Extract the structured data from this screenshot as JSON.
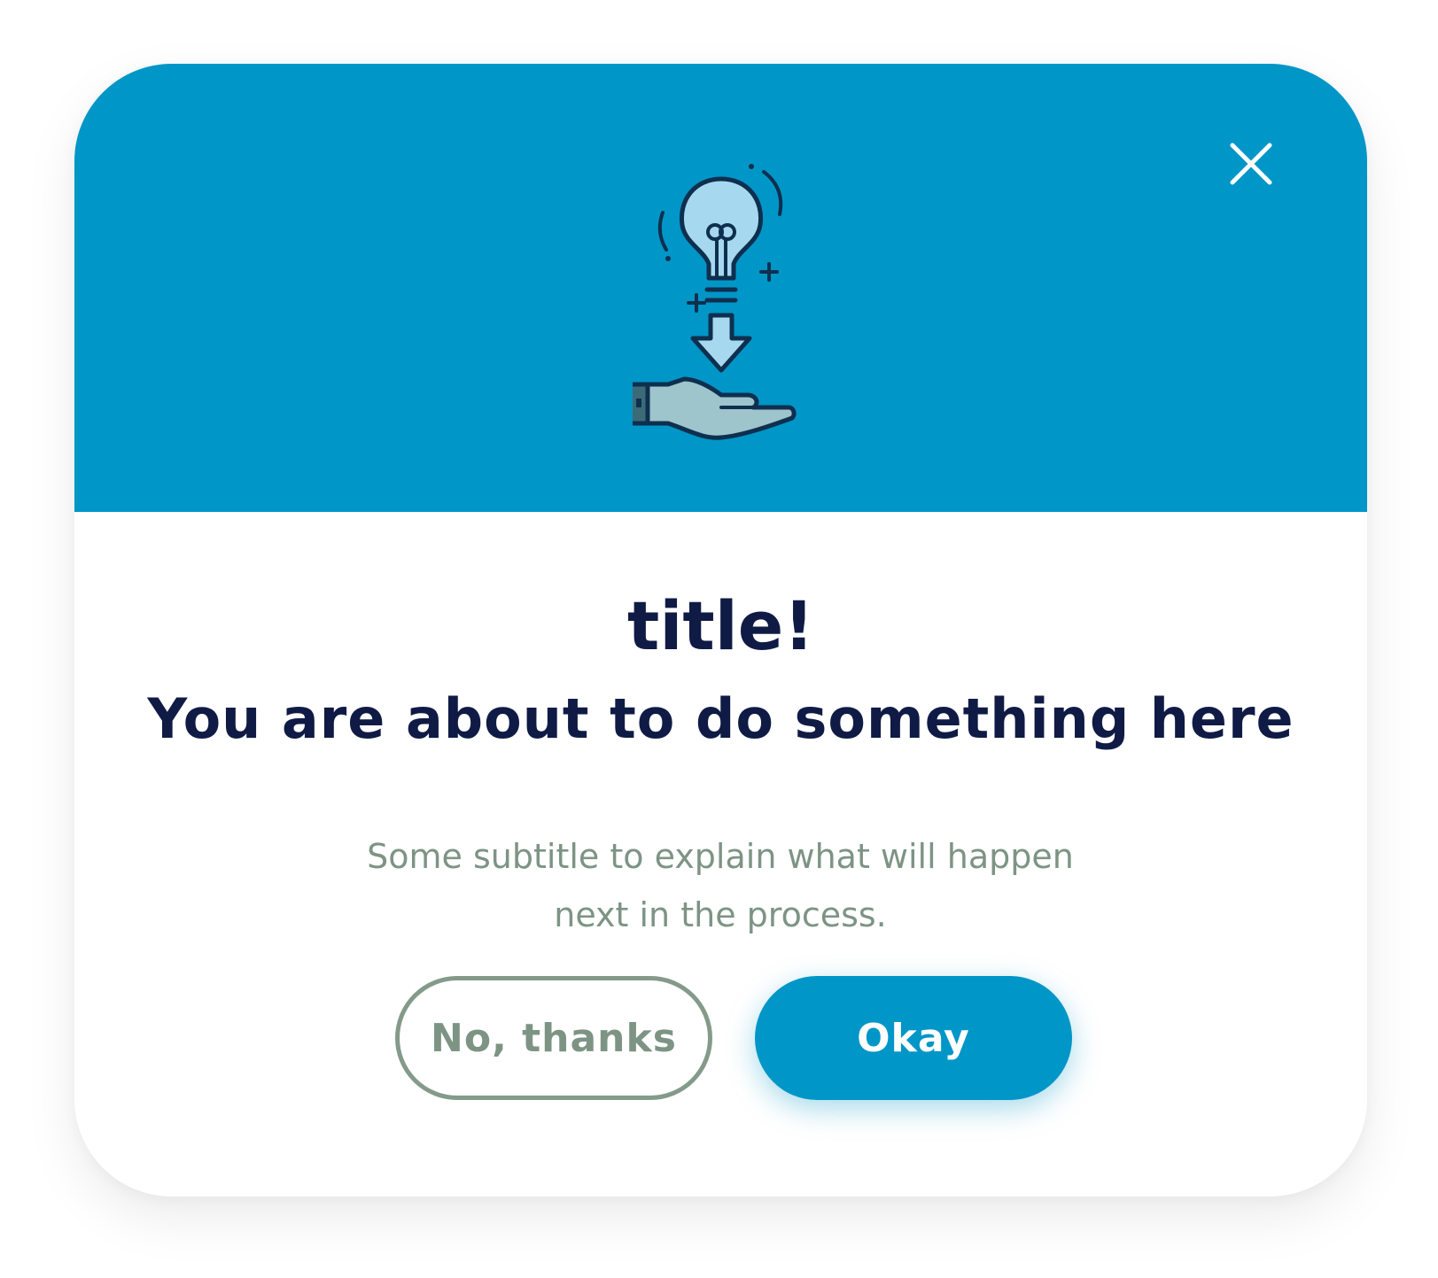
{
  "dialog": {
    "title": "title!",
    "heading": "You are about to do something here",
    "subtitle_line1": "Some subtitle to explain what will happen",
    "subtitle_line2": "next in the process.",
    "close_icon": "close-icon",
    "illustration_icon": "idea-in-hand-icon"
  },
  "actions": {
    "secondary_label": "No, thanks",
    "primary_label": "Okay"
  },
  "colors": {
    "accent": "#0096c7",
    "text_dark": "#0f1b45",
    "text_muted": "#7d9484",
    "outline": "#849a8b",
    "background": "#ffffff"
  }
}
